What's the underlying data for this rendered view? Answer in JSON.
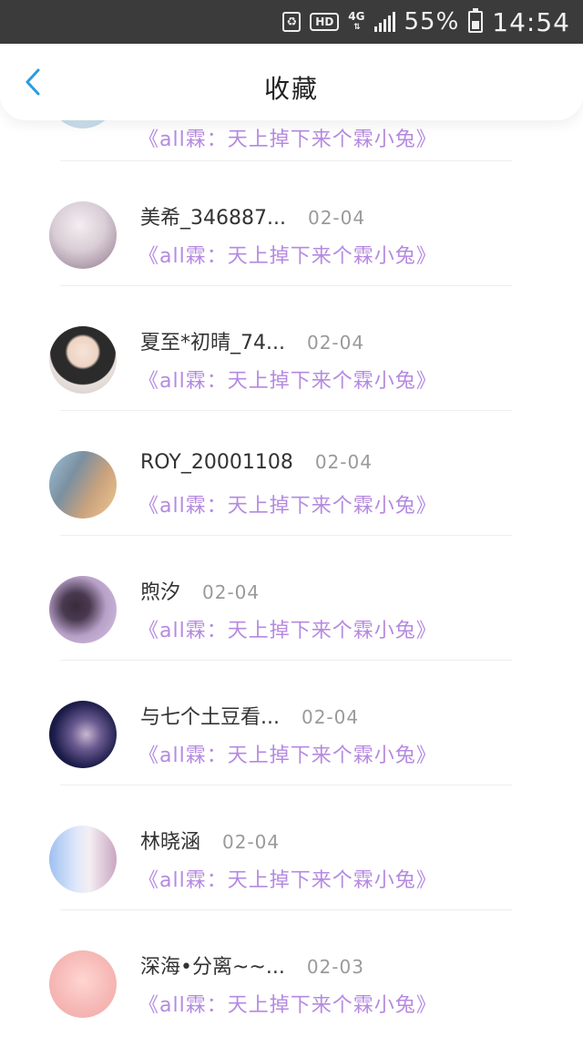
{
  "status_bar": {
    "hd": "HD",
    "network": "4G",
    "battery": "55%",
    "time": "14:54"
  },
  "header": {
    "title": "收藏",
    "back_icon": "chevron-left-icon"
  },
  "colors": {
    "accent_blue": "#2a9be0",
    "title_purple": "#b58ae0"
  },
  "partial_item": {
    "title": "《all霖：天上掉下来个霖小兔》"
  },
  "items": [
    {
      "name": "美希_346887...",
      "date": "02-04",
      "title": "《all霖：天上掉下来个霖小兔》"
    },
    {
      "name": "夏至*初晴_74...",
      "date": "02-04",
      "title": "《all霖：天上掉下来个霖小兔》"
    },
    {
      "name": "ROY_20001108",
      "date": "02-04",
      "title": "《all霖：天上掉下来个霖小兔》"
    },
    {
      "name": "煦汐",
      "date": "02-04",
      "title": "《all霖：天上掉下来个霖小兔》"
    },
    {
      "name": "与七个土豆看...",
      "date": "02-04",
      "title": "《all霖：天上掉下来个霖小兔》"
    },
    {
      "name": "林晓涵",
      "date": "02-04",
      "title": "《all霖：天上掉下来个霖小兔》"
    },
    {
      "name": "深海•分离~~...",
      "date": "02-03",
      "title": "《all霖：天上掉下来个霖小兔》"
    }
  ]
}
